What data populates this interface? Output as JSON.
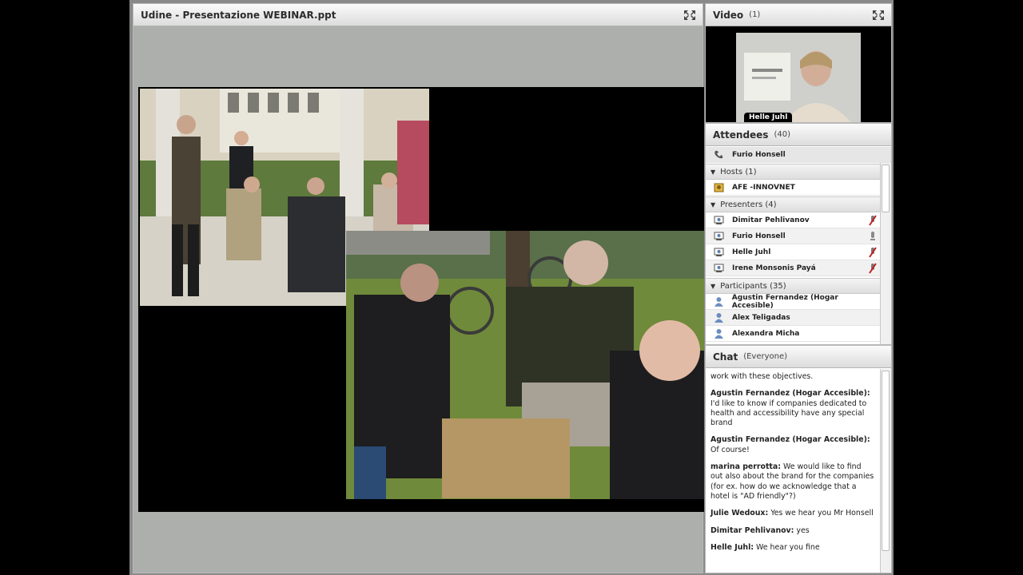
{
  "share": {
    "title": "Udine - Presentazione WEBINAR.ppt"
  },
  "video": {
    "title": "Video",
    "count": "(1)",
    "speaker": "Helle Juhl"
  },
  "attendees": {
    "title": "Attendees",
    "count": "(40)",
    "active_speaker": "Furio Honsell",
    "hosts_label": "Hosts (1)",
    "hosts": [
      "AFE -INNOVNET"
    ],
    "presenters_label": "Presenters (4)",
    "presenters": [
      "Dimitar Pehlivanov",
      "Furio Honsell",
      "Helle Juhl",
      "Irene Monsonis Payá"
    ],
    "participants_label": "Participants (35)",
    "participants": [
      "Agustin Fernandez (Hogar Accesible)",
      "Alex Teligadas",
      "Alexandra Micha"
    ]
  },
  "chat": {
    "title": "Chat",
    "scope": "(Everyone)",
    "messages": [
      {
        "who": "",
        "text": "work with these objectives."
      },
      {
        "who": "Agustin Fernandez (Hogar Accesible):",
        "text": "I'd like to know if companies dedicated to health and accessibility have any special brand"
      },
      {
        "who": "Agustin Fernandez (Hogar Accesible):",
        "text": "Of course!"
      },
      {
        "who": "marina perrotta:",
        "text": "We would like to find out also about the brand for the companies (for ex. how do we acknowledge that a hotel is \"AD friendly\"?)"
      },
      {
        "who": "Julie Wedoux:",
        "text": "Yes we hear you Mr Honsell"
      },
      {
        "who": "Dimitar Pehlivanov:",
        "text": "yes"
      },
      {
        "who": "Helle Juhl:",
        "text": "We hear you fine"
      }
    ]
  },
  "icons": {
    "fullscreen": "fullscreen-icon",
    "phone": "phone-icon",
    "host": "host-icon",
    "presenter": "presenter-icon",
    "participant": "participant-icon",
    "mic_off": "mic-muted-icon",
    "mic_on": "mic-icon"
  }
}
